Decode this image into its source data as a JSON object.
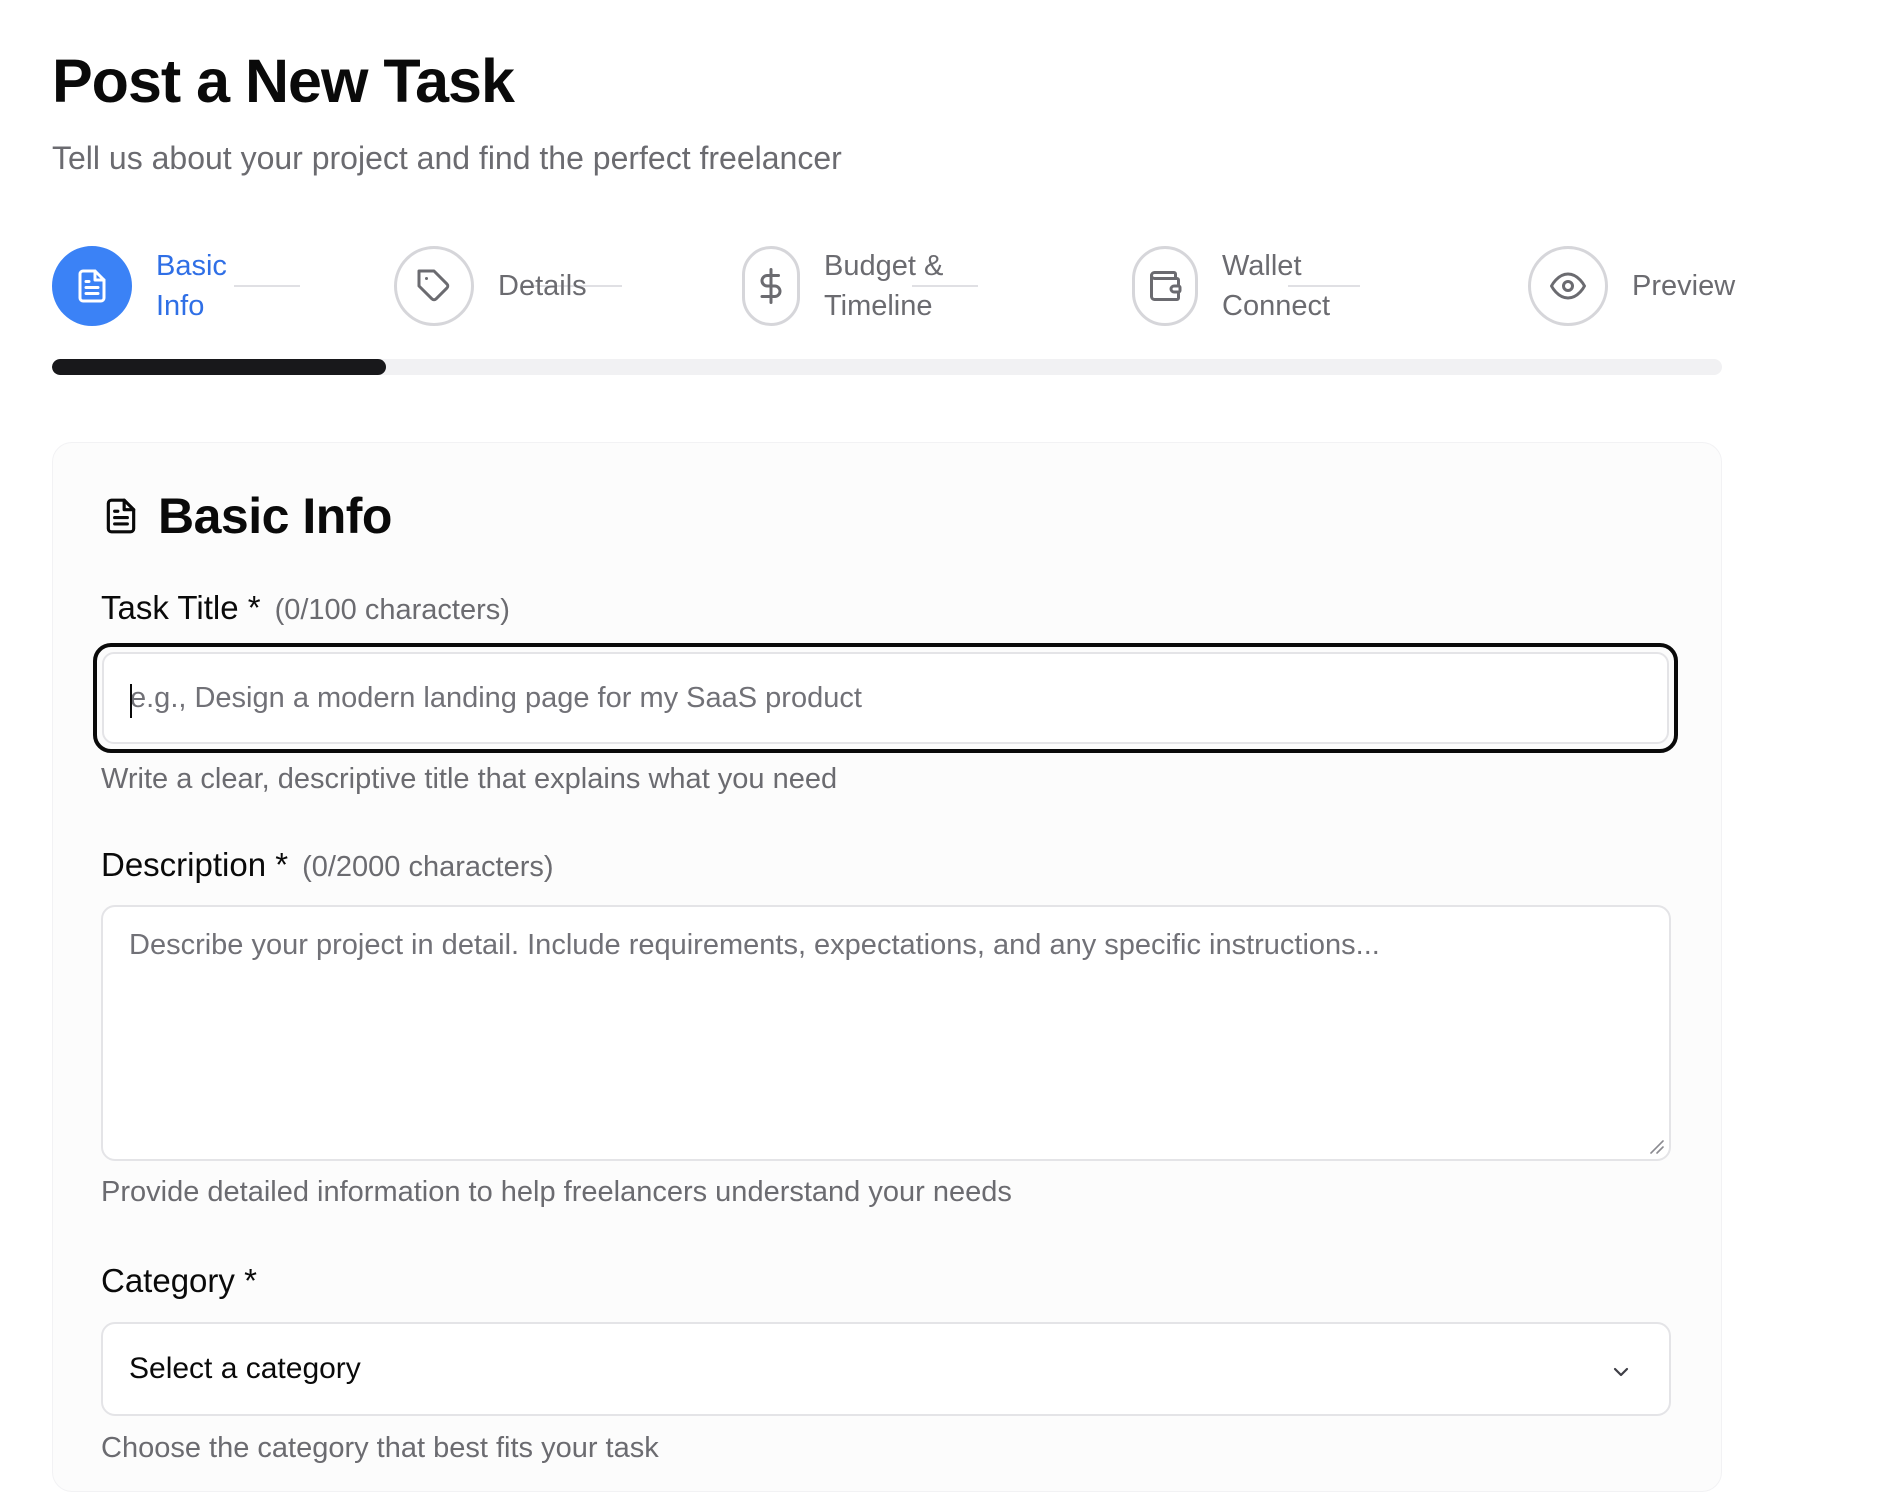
{
  "header": {
    "title": "Post a New Task",
    "subtitle": "Tell us about your project and find the perfect freelancer"
  },
  "steps": [
    {
      "label": "Basic\nInfo",
      "icon": "file-text-icon",
      "active": true
    },
    {
      "label": "Details",
      "icon": "tag-icon",
      "active": false
    },
    {
      "label": "Budget &\nTimeline",
      "icon": "dollar-icon",
      "active": false
    },
    {
      "label": "Wallet\nConnect",
      "icon": "wallet-icon",
      "active": false
    },
    {
      "label": "Preview",
      "icon": "eye-icon",
      "active": false
    }
  ],
  "progress": {
    "current_step": 1,
    "total_steps": 5,
    "fraction": 0.2
  },
  "section": {
    "title": "Basic Info",
    "icon": "file-text-icon"
  },
  "form": {
    "task_title": {
      "label": "Task Title *",
      "counter": "(0/100 characters)",
      "value": "",
      "placeholder": "e.g., Design a modern landing page for my SaaS product",
      "hint": "Write a clear, descriptive title that explains what you need"
    },
    "description": {
      "label": "Description *",
      "counter": "(0/2000 characters)",
      "value": "",
      "placeholder": "Describe your project in detail. Include requirements, expectations, and any specific instructions...",
      "hint": "Provide detailed information to help freelancers understand your needs"
    },
    "category": {
      "label": "Category *",
      "selected": "Select a category",
      "hint": "Choose the category that best fits your task"
    }
  },
  "colors": {
    "accent": "#3b82f6",
    "accent_text": "#2f6fe6",
    "progress_fill": "#18181b",
    "muted_text": "#6b6b70"
  }
}
